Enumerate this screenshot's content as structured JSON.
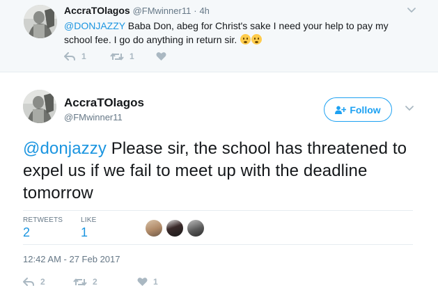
{
  "parent_tweet": {
    "name": "AccraTOlagos",
    "handle": "@FMwinner11",
    "separator": "·",
    "time": "4h",
    "mention": "@DONJAZZY",
    "text": " Baba Don, abeg for Christ's sake I need your help to pay my school fee. I go do anything in return sir. ",
    "emojis": [
      "frowning-face",
      "frowning-face"
    ],
    "reply_count": "1",
    "retweet_count": "1",
    "like_count": ""
  },
  "main_tweet": {
    "name": "AccraTOlagos",
    "handle": "@FMwinner11",
    "follow_label": "Follow",
    "mention": "@donjazzy",
    "text": " Please sir, the school has threatened to expel us if we fail to meet up with the deadline tomorrow",
    "retweets_label": "RETWEETS",
    "retweets_value": "2",
    "likes_label": "LIKE",
    "likes_value": "1",
    "timestamp": "12:42 AM - 27 Feb 2017",
    "reply_count": "2",
    "retweet_count": "2",
    "like_count": "1"
  },
  "colors": {
    "accent": "#1da1f2",
    "link": "#1b95e0",
    "muted": "#657786",
    "icon": "#aab8c2",
    "parent_bg": "#f5f8fa"
  }
}
